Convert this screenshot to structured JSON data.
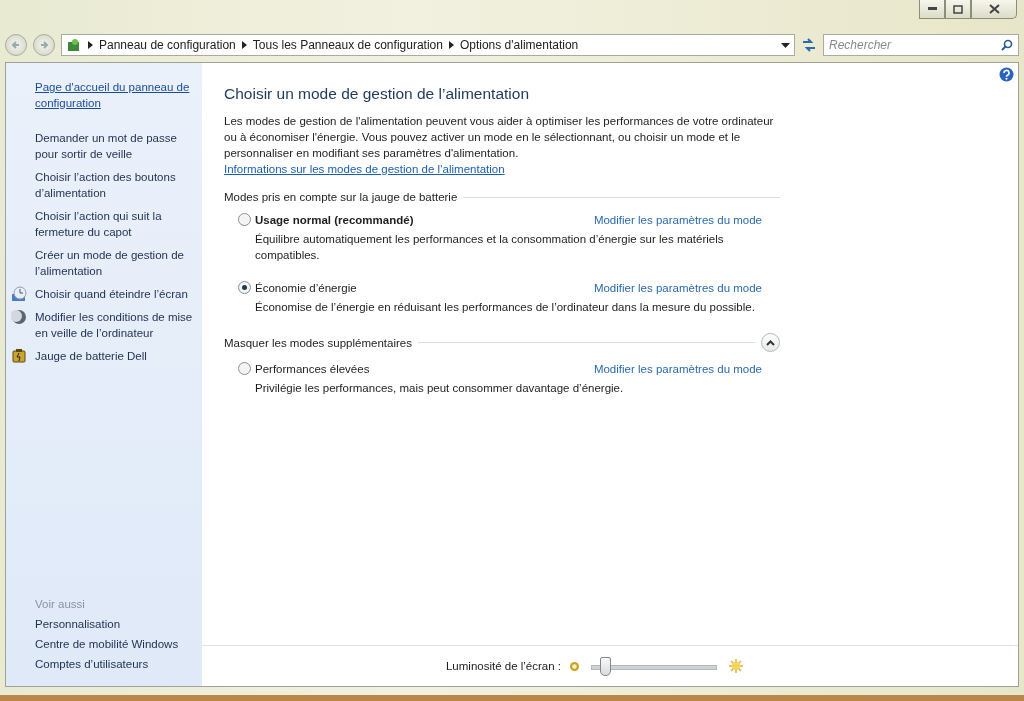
{
  "address_bar": {
    "crumbs": [
      "Panneau de configuration",
      "Tous les Panneaux de configuration",
      "Options d'alimentation"
    ]
  },
  "search": {
    "placeholder": "Rechercher"
  },
  "sidebar": {
    "home_link": "Page d'accueil du panneau de configuration",
    "tasks": [
      {
        "label": "Demander un mot de passe pour sortir de veille",
        "kind": "plain"
      },
      {
        "label": "Choisir l’action des boutons d’alimentation",
        "kind": "plain"
      },
      {
        "label": "Choisir l’action qui suit la fermeture du capot",
        "kind": "plain"
      },
      {
        "label": "Créer un mode de gestion de l’alimentation",
        "kind": "plain"
      },
      {
        "label": "Choisir quand éteindre l’écran",
        "kind": "screen"
      },
      {
        "label": "Modifier les conditions de mise en veille de l’ordinateur",
        "kind": "moon"
      },
      {
        "label": "Jauge de batterie Dell",
        "kind": "battery"
      }
    ],
    "see_also": {
      "title": "Voir aussi",
      "links": [
        "Personnalisation",
        "Centre de mobilité Windows",
        "Comptes d’utilisateurs"
      ]
    }
  },
  "main": {
    "title": "Choisir un mode de gestion de l’alimentation",
    "intro": "Les modes de gestion de l'alimentation peuvent vous aider à optimiser les performances de votre ordinateur ou à économiser l'énergie. Vous pouvez activer un mode en le sélectionnant, ou choisir un mode et le personnaliser en modifiant ses paramètres d'alimentation.",
    "intro_link": "Informations sur les modes de gestion de l’alimentation",
    "groups": [
      {
        "title": "Modes pris en compte sur la jauge de batterie",
        "plans": [
          {
            "name": "Usage normal (recommandé)",
            "bold": true,
            "selected": false,
            "link": "Modifier les paramètres du mode",
            "description": "Équilibre automatiquement les performances et la consommation d’énergie sur les matériels compatibles."
          },
          {
            "name": "Économie d’énergie",
            "bold": false,
            "selected": true,
            "link": "Modifier les paramètres du mode",
            "description": "Économise de l’énergie en réduisant les performances de l’ordinateur dans la mesure du possible."
          }
        ]
      },
      {
        "title": "Masquer les modes supplémentaires",
        "expanded": true,
        "plans": [
          {
            "name": "Performances élevées",
            "bold": false,
            "selected": false,
            "link": "Modifier les paramètres du mode",
            "description": "Privilégie les performances, mais peut consommer davantage d’énergie."
          }
        ]
      }
    ]
  },
  "brightness": {
    "label": "Luminosité de l’écran :",
    "level": 0.1
  }
}
